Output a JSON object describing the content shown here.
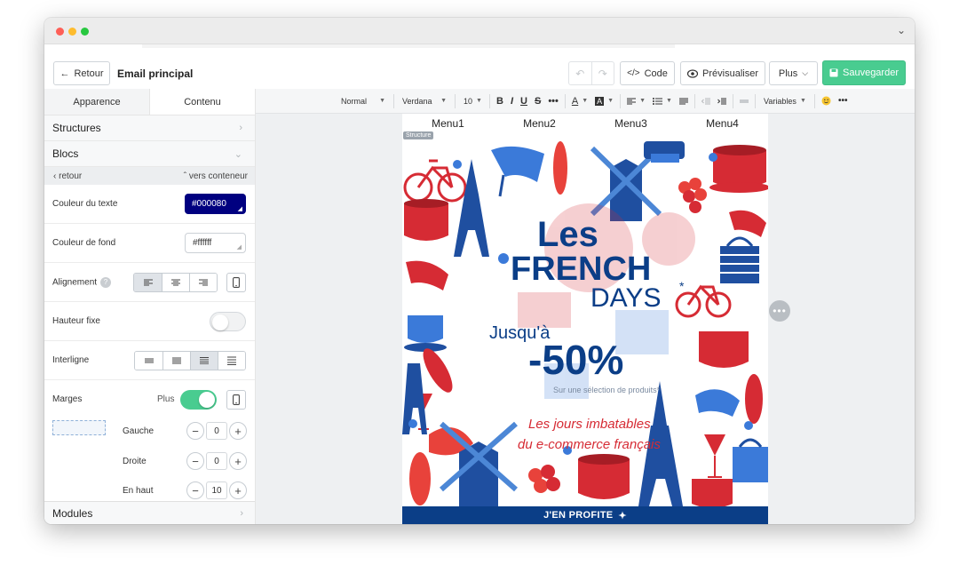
{
  "topbar": {
    "back_label": "Retour",
    "doc_title": "Email principal",
    "code_label": "Code",
    "preview_label": "Prévisualiser",
    "plus_label": "Plus",
    "save_label": "Sauvegarder"
  },
  "sidebar": {
    "tabs": [
      {
        "label": "Apparence",
        "active": true
      },
      {
        "label": "Contenu",
        "active": false
      }
    ],
    "structures_label": "Structures",
    "blocs_label": "Blocs",
    "back_label": "retour",
    "container_label": "vers conteneur",
    "text_color_label": "Couleur du texte",
    "text_color_value": "#000080",
    "bg_color_label": "Couleur de fond",
    "bg_color_value": "#ffffff",
    "alignment_label": "Alignement",
    "fixed_height_label": "Hauteur fixe",
    "line_height_label": "Interligne",
    "margins_label": "Marges",
    "margins_plus_label": "Plus",
    "margin_left_label": "Gauche",
    "margin_left_value": "0",
    "margin_right_label": "Droite",
    "margin_right_value": "0",
    "margin_top_label": "En haut",
    "margin_top_value": "10",
    "modules_label": "Modules"
  },
  "format_toolbar": {
    "style": "Normal",
    "font": "Verdana",
    "size": "10",
    "variables_label": "Variables"
  },
  "email": {
    "menu": [
      "Menu1",
      "Menu2",
      "Menu3",
      "Menu4"
    ],
    "structure_tag": "Structure",
    "banner": {
      "line1": "Les",
      "line2": "FRENCH",
      "line3": "DAYS",
      "asterisk": "*",
      "upto": "Jusqu'à",
      "discount": "-50%",
      "note": "Sur une sélection de produits*",
      "tagline1": "Les jours imbatables",
      "tagline2": "du e-commerce français"
    },
    "cta_label": "J'EN PROFITE"
  },
  "colors": {
    "save_green": "#49cc90",
    "navy": "#000080",
    "banner_blue": "#0b3e87",
    "banner_red": "#d62b34"
  }
}
